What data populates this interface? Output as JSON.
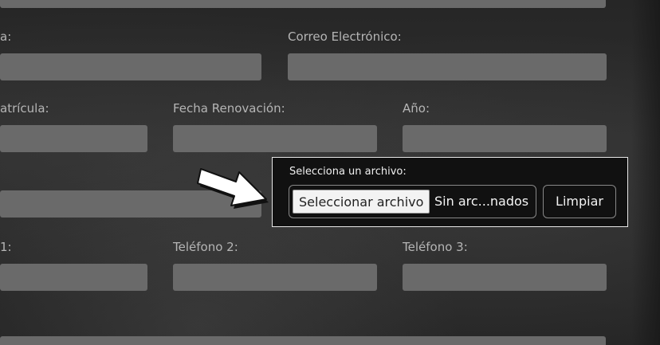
{
  "form": {
    "fields": [
      {
        "key": "nombre",
        "label": "a:"
      },
      {
        "key": "correo",
        "label": "Correo Electrónico:"
      },
      {
        "key": "matricula",
        "label": "atrícula:"
      },
      {
        "key": "fecha_renovacion",
        "label": "Fecha Renovación:"
      },
      {
        "key": "anio",
        "label": "Año:"
      },
      {
        "key": "telefono1",
        "label": "1:"
      },
      {
        "key": "telefono2",
        "label": "Teléfono 2:"
      },
      {
        "key": "telefono3",
        "label": "Teléfono 3:"
      }
    ],
    "file_upload": {
      "label": "Selecciona un archivo:",
      "button_label": "Seleccionar archivo",
      "status_text": "Sin arc...nados",
      "clear_label": "Limpiar"
    }
  },
  "colors": {
    "input_bg": "#6a6a6a",
    "panel_bg": "#111111",
    "panel_border": "#e8e8e8",
    "label_text": "#b5b5b5"
  },
  "icons": [
    "arrow-right-icon"
  ]
}
